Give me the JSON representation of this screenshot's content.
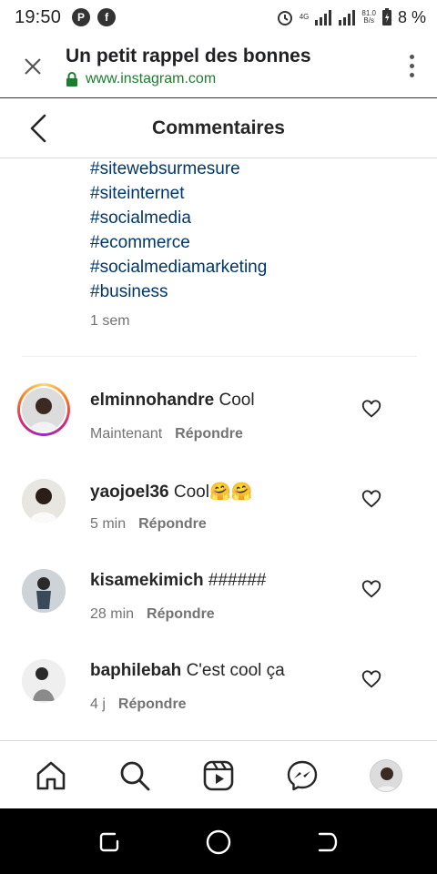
{
  "status_bar": {
    "time": "19:50",
    "network": "4G",
    "speed_value": "81.0",
    "speed_unit": "B/s",
    "battery": "8 %"
  },
  "browser": {
    "page_title": "Un petit rappel des bonnes",
    "url": "www.instagram.com"
  },
  "header": {
    "title": "Commentaires"
  },
  "caption": {
    "hashtags": [
      "#sitewebsurmesure",
      "#siteinternet",
      "#socialmedia",
      "#ecommerce",
      "#socialmediamarketing",
      "#business"
    ],
    "time": "1 sem"
  },
  "comments": [
    {
      "username": "elminnohandre",
      "text": "Cool",
      "time": "Maintenant",
      "reply_label": "Répondre",
      "story_ring": true
    },
    {
      "username": "yaojoel36",
      "text": "Cool🤗🤗",
      "time": "5 min",
      "reply_label": "Répondre",
      "story_ring": false
    },
    {
      "username": "kisamekimich",
      "text": "######",
      "time": "28 min",
      "reply_label": "Répondre",
      "story_ring": false
    },
    {
      "username": "baphilebah",
      "text": "C'est cool ça",
      "time": "4 j",
      "reply_label": "Répondre",
      "story_ring": false
    }
  ],
  "bottom_nav": {
    "items": [
      "home-icon",
      "search-icon",
      "reels-icon",
      "messenger-icon",
      "profile-avatar"
    ]
  },
  "colors": {
    "hashtag": "#00376b",
    "secure_green": "#1b7d2e",
    "meta_gray": "#737373"
  }
}
